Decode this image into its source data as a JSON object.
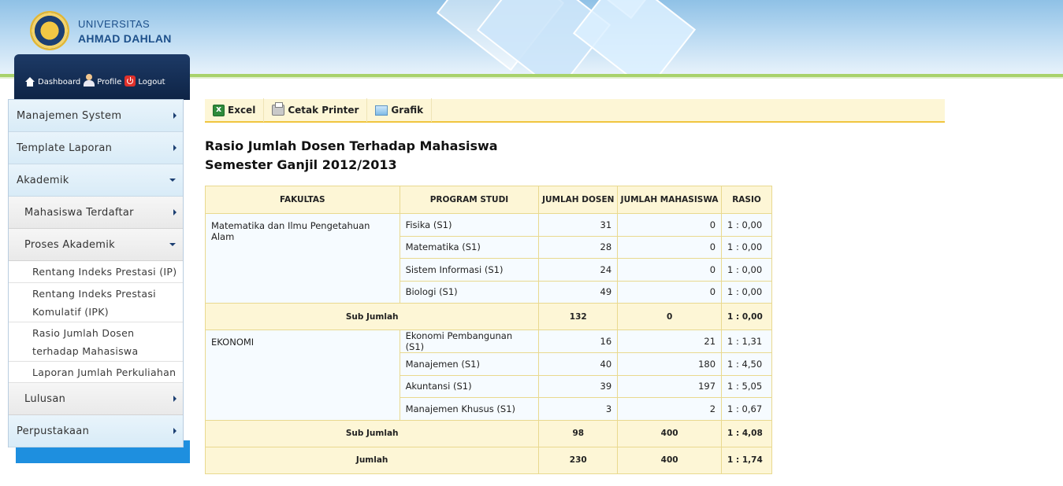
{
  "header": {
    "university_line1": "UNIVERSITAS",
    "university_line2": "AHMAD DAHLAN"
  },
  "topnav": {
    "dashboard": "Dashboard",
    "profile": "Profile",
    "logout": "Logout"
  },
  "menu": {
    "manajemen_system": "Manajemen System",
    "template_laporan": "Template Laporan",
    "akademik": "Akademik",
    "mahasiswa_terdaftar": "Mahasiswa Terdaftar",
    "proses_akademik": "Proses Akademik",
    "rentang_ip": "Rentang Indeks Prestasi (IP)",
    "rentang_ipk_1": "Rentang Indeks Prestasi",
    "rentang_ipk_2": "Komulatif (IPK)",
    "rasio_1": "Rasio Jumlah Dosen",
    "rasio_2": "terhadap Mahasiswa",
    "laporan_perkuliahan": "Laporan Jumlah Perkuliahan",
    "lulusan": "Lulusan",
    "perpustakaan": "Perpustakaan"
  },
  "toolbar": {
    "excel": "Excel",
    "cetak": "Cetak Printer",
    "grafik": "Grafik"
  },
  "report": {
    "title": "Rasio Jumlah Dosen Terhadap Mahasiswa",
    "subtitle": "Semester Ganjil 2012/2013"
  },
  "table": {
    "headers": [
      "FAKULTAS",
      "PROGRAM STUDI",
      "JUMLAH DOSEN",
      "JUMLAH MAHASISWA",
      "RASIO"
    ],
    "groups": [
      {
        "fakultas": "Matematika dan Ilmu Pengetahuan Alam",
        "rows": [
          {
            "prodi": "Fisika (S1)",
            "dosen": "31",
            "mhs": "0",
            "rasio": "1 : 0,00"
          },
          {
            "prodi": "Matematika (S1)",
            "dosen": "28",
            "mhs": "0",
            "rasio": "1 : 0,00"
          },
          {
            "prodi": "Sistem Informasi (S1)",
            "dosen": "24",
            "mhs": "0",
            "rasio": "1 : 0,00"
          },
          {
            "prodi": "Biologi (S1)",
            "dosen": "49",
            "mhs": "0",
            "rasio": "1 : 0,00"
          }
        ],
        "sub": {
          "label": "Sub Jumlah",
          "dosen": "132",
          "mhs": "0",
          "rasio": "1 : 0,00"
        }
      },
      {
        "fakultas": "EKONOMI",
        "rows": [
          {
            "prodi": "Ekonomi Pembangunan (S1)",
            "dosen": "16",
            "mhs": "21",
            "rasio": "1 : 1,31"
          },
          {
            "prodi": "Manajemen (S1)",
            "dosen": "40",
            "mhs": "180",
            "rasio": "1 : 4,50"
          },
          {
            "prodi": "Akuntansi (S1)",
            "dosen": "39",
            "mhs": "197",
            "rasio": "1 : 5,05"
          },
          {
            "prodi": "Manajemen Khusus (S1)",
            "dosen": "3",
            "mhs": "2",
            "rasio": "1 : 0,67"
          }
        ],
        "sub": {
          "label": "Sub Jumlah",
          "dosen": "98",
          "mhs": "400",
          "rasio": "1 : 4,08"
        }
      }
    ],
    "total": {
      "label": "Jumlah",
      "dosen": "230",
      "mhs": "400",
      "rasio": "1 : 1,74"
    }
  }
}
